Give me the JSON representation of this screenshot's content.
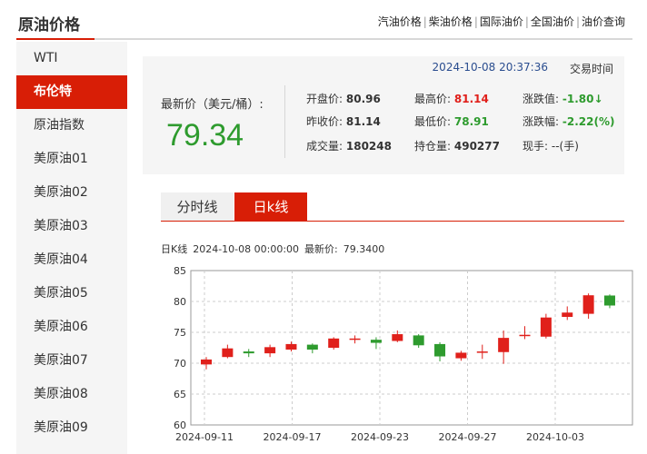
{
  "header": {
    "title": "原油价格",
    "links": [
      "汽油价格",
      "柴油价格",
      "国际油价",
      "全国油价",
      "油价查询"
    ],
    "separator": "|"
  },
  "sidebar": {
    "items": [
      {
        "label": "WTI",
        "active": false
      },
      {
        "label": "布伦特",
        "active": true
      },
      {
        "label": "原油指数",
        "active": false
      },
      {
        "label": "美原油01",
        "active": false
      },
      {
        "label": "美原油02",
        "active": false
      },
      {
        "label": "美原油03",
        "active": false
      },
      {
        "label": "美原油04",
        "active": false
      },
      {
        "label": "美原油05",
        "active": false
      },
      {
        "label": "美原油06",
        "active": false
      },
      {
        "label": "美原油07",
        "active": false
      },
      {
        "label": "美原油08",
        "active": false
      },
      {
        "label": "美原油09",
        "active": false
      }
    ]
  },
  "quote": {
    "time": "2024-10-08 20:37:36",
    "time_label": "交易时间",
    "latest_label": "最新价（美元/桶）:",
    "latest_value": "79.34",
    "open_label": "开盘价:",
    "open_value": "80.96",
    "high_label": "最高价:",
    "high_value": "81.14",
    "change_label": "涨跌值:",
    "change_value": "-1.80↓",
    "prev_label": "昨收价:",
    "prev_value": "81.14",
    "low_label": "最低价:",
    "low_value": "78.91",
    "pct_label": "涨跌幅:",
    "pct_value": "-2.22(%)",
    "vol_label": "成交量:",
    "vol_value": "180248",
    "oi_label": "持仓量:",
    "oi_value": "490277",
    "hand_label": "现手:",
    "hand_value": "--(手)"
  },
  "tabs": {
    "minute": "分时线",
    "daily": "日k线"
  },
  "chart_info": {
    "label": "日K线",
    "date": "2024-10-08 00:00:00",
    "latest_label": "最新价:",
    "latest_value": "79.3400"
  },
  "colors": {
    "up": "#e0201b",
    "down": "#2e9b2e",
    "accent": "#d81e06"
  },
  "chart_data": {
    "type": "candlestick",
    "ylim": [
      60,
      85
    ],
    "yticks": [
      60,
      65,
      70,
      75,
      80,
      85
    ],
    "xtick_labels": [
      "2024-09-11",
      "2024-09-17",
      "2024-09-23",
      "2024-09-27",
      "2024-10-03"
    ],
    "xtick_index": [
      0,
      6,
      12,
      18,
      24
    ],
    "candles": [
      {
        "date": "2024-09-11",
        "open": 69.8,
        "close": 70.6,
        "high": 71.0,
        "low": 69.0
      },
      {
        "date": "2024-09-12",
        "open": 71.0,
        "close": 72.4,
        "high": 73.0,
        "low": 70.8
      },
      {
        "date": "2024-09-13",
        "open": 71.9,
        "close": 71.6,
        "high": 72.3,
        "low": 71.0
      },
      {
        "date": "2024-09-16",
        "open": 71.6,
        "close": 72.6,
        "high": 73.0,
        "low": 71.0
      },
      {
        "date": "2024-09-17",
        "open": 72.2,
        "close": 73.1,
        "high": 73.5,
        "low": 71.9
      },
      {
        "date": "2024-09-18",
        "open": 73.0,
        "close": 72.2,
        "high": 73.2,
        "low": 71.6
      },
      {
        "date": "2024-09-19",
        "open": 72.5,
        "close": 74.0,
        "high": 74.2,
        "low": 72.2
      },
      {
        "date": "2024-09-20",
        "open": 73.8,
        "close": 74.0,
        "high": 74.5,
        "low": 73.2
      },
      {
        "date": "2024-09-23",
        "open": 73.8,
        "close": 73.3,
        "high": 74.2,
        "low": 72.3
      },
      {
        "date": "2024-09-24",
        "open": 73.6,
        "close": 74.7,
        "high": 75.3,
        "low": 73.4
      },
      {
        "date": "2024-09-25",
        "open": 74.5,
        "close": 72.9,
        "high": 74.7,
        "low": 72.5
      },
      {
        "date": "2024-09-26",
        "open": 73.1,
        "close": 71.1,
        "high": 73.4,
        "low": 70.3
      },
      {
        "date": "2024-09-27",
        "open": 70.8,
        "close": 71.7,
        "high": 72.0,
        "low": 70.4
      },
      {
        "date": "2024-09-30",
        "open": 71.9,
        "close": 71.9,
        "high": 73.0,
        "low": 70.7
      },
      {
        "date": "2024-10-01",
        "open": 71.8,
        "close": 74.1,
        "high": 75.3,
        "low": 69.9
      },
      {
        "date": "2024-10-02",
        "open": 74.5,
        "close": 74.6,
        "high": 76.0,
        "low": 73.9
      },
      {
        "date": "2024-10-03",
        "open": 74.3,
        "close": 77.4,
        "high": 78.0,
        "low": 74.0
      },
      {
        "date": "2024-10-04",
        "open": 77.5,
        "close": 78.2,
        "high": 79.2,
        "low": 77.0
      },
      {
        "date": "2024-10-07",
        "open": 78.0,
        "close": 81.0,
        "high": 81.3,
        "low": 77.2
      },
      {
        "date": "2024-10-08",
        "open": 80.96,
        "close": 79.34,
        "high": 81.14,
        "low": 78.91
      }
    ],
    "grid": true
  }
}
